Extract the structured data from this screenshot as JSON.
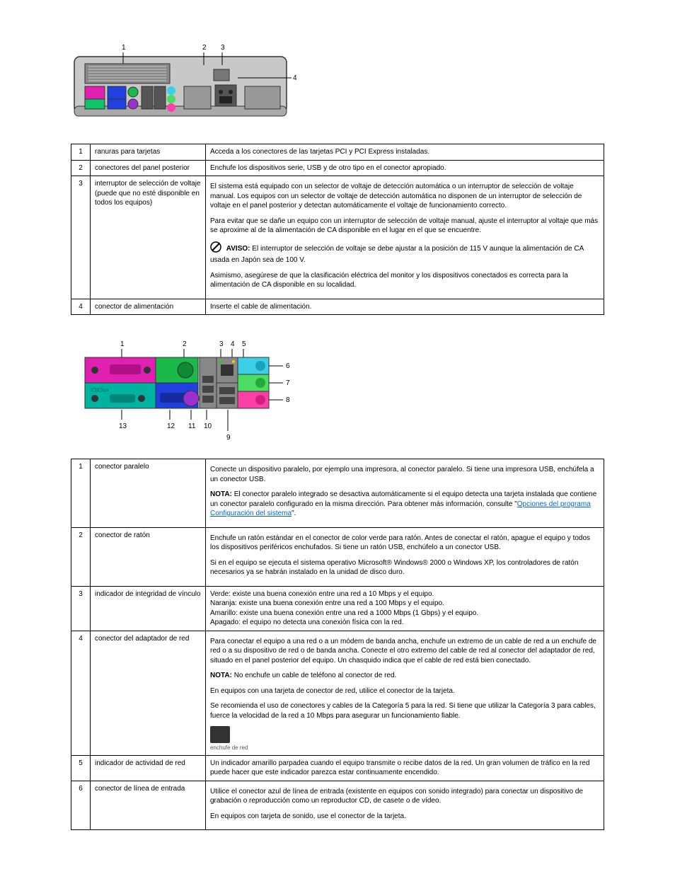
{
  "diagram1": {
    "callouts": [
      "1",
      "2",
      "3",
      "4"
    ]
  },
  "table1": {
    "rows": [
      {
        "num": "1",
        "label": "ranuras para tarjetas",
        "desc": "Acceda a los conectores de las tarjetas PCI y PCI Express instaladas."
      },
      {
        "num": "2",
        "label": "conectores del panel posterior",
        "desc": "Enchufe los dispositivos serie, USB y de otro tipo en el conector apropiado."
      },
      {
        "num": "3",
        "label": "interruptor de selección de voltaje (puede que no esté disponible en todos los equipos)",
        "desc_parts": {
          "p1": "El sistema está equipado con un selector de voltaje de detección automática o un interruptor de selección de voltaje manual. Los equipos con un selector de voltaje de detección automática no disponen de un interruptor de selección de voltaje en el panel posterior y detectan automáticamente el voltaje de funcionamiento correcto.",
          "p2": "Para evitar que se dañe un equipo con un interruptor de selección de voltaje manual, ajuste el interruptor al voltaje que más se aproxime al de la alimentación de CA disponible en el lugar en el que se encuentre.",
          "notice_label": "AVISO:",
          "notice": "El interruptor de selección de voltaje se debe ajustar a la posición de 115 V aunque la alimentación de CA usada en Japón sea de 100 V.",
          "p3": "Asimismo, asegúrese de que la clasificación eléctrica del monitor y los dispositivos conectados es correcta para la alimentación de CA disponible en su localidad."
        }
      },
      {
        "num": "4",
        "label": "conector de alimentación",
        "desc": "Inserte el cable de alimentación."
      }
    ]
  },
  "diagram2": {
    "top_callouts": [
      "1",
      "2",
      "3",
      "4",
      "5"
    ],
    "right_callouts": [
      "6",
      "7",
      "8"
    ],
    "bottom_callouts": [
      "13",
      "12",
      "11",
      "10",
      "9"
    ]
  },
  "table2": {
    "rows": [
      {
        "num": "1",
        "label": "conector paralelo",
        "desc_parts": {
          "p1": "Conecte un dispositivo paralelo, por ejemplo una impresora, al conector paralelo. Si tiene una impresora USB, enchúfela a un conector USB.",
          "note_label": "NOTA:",
          "p2a": "El conector paralelo integrado se desactiva automáticamente si el equipo detecta una tarjeta instalada que contiene un conector paralelo configurado en la misma dirección. Para obtener más información, consulte \"",
          "link": "Opciones del programa Configuración del sistema",
          "p2b": "\"."
        }
      },
      {
        "num": "2",
        "label": "conector de ratón",
        "desc_parts": {
          "p1": "Enchufe un ratón estándar en el conector de color verde para ratón. Antes de conectar el ratón, apague el equipo y todos los dispositivos periféricos enchufados. Si tiene un ratón USB, enchúfelo a un conector USB.",
          "p2a": "Si en el equipo se ejecuta el sistema operativo Microsoft",
          "reg1": "®",
          "p2b": " Windows",
          "reg2": "®",
          "p2c": " 2000 o Windows XP, los controladores de ratón necesarios ya se habrán instalado en la unidad de disco duro."
        }
      },
      {
        "num": "3",
        "label": "indicador de integridad de vínculo",
        "desc_lines": [
          "Verde: existe una buena conexión entre una red a 10 Mbps y el equipo.",
          "Naranja: existe una buena conexión entre una red a 100 Mbps y el equipo.",
          "Amarillo: existe una buena conexión entre una red a 1000 Mbps (1 Gbps) y el equipo.",
          "Apagado: el equipo no detecta una conexión física con la red."
        ]
      },
      {
        "num": "4",
        "label": "conector del adaptador de red",
        "desc_parts": {
          "p1": "Para conectar el equipo a una red o a un módem de banda ancha, enchufe un extremo de un cable de red a un enchufe de red o a su dispositivo de red o de banda ancha. Conecte el otro extremo del cable de red al conector del adaptador de red, situado en el panel posterior del equipo. Un chasquido indica que el cable de red está bien conectado.",
          "note_label": "NOTA:",
          "note": "No enchufe un cable de teléfono al conector de red.",
          "p2": "En equipos con una tarjeta de conector de red, utilice el conector de la tarjeta.",
          "p3": "Se recomienda el uso de conectores y cables de la Categoría 5 para la red. Si tiene que utilizar la Categoría 3 para cables, fuerce la velocidad de la red a 10 Mbps para asegurar un funcionamiento fiable.",
          "icon_caption": "enchufe de red"
        }
      },
      {
        "num": "5",
        "label": "indicador de actividad de red",
        "desc": "Un indicador amarillo parpadea cuando el equipo transmite o recibe datos de la red. Un gran volumen de tráfico en la red puede hacer que este indicador parezca estar continuamente encendido."
      },
      {
        "num": "6",
        "label": "conector de línea de entrada",
        "desc": "Utilice el conector azul de línea de entrada (existente en equipos con sonido integrado) para conectar un dispositivo de grabación o reproducción como un reproductor CD, de casete o de vídeo.",
        "desc2": "En equipos con tarjeta de sonido, use el conector de la tarjeta."
      }
    ]
  }
}
